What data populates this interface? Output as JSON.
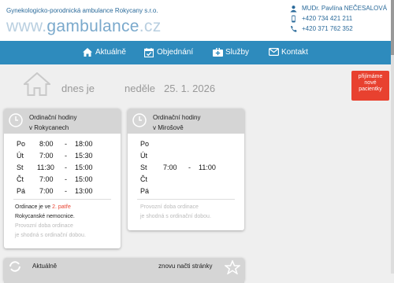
{
  "header": {
    "company": "Gynekologicko-porodnická ambulance Rokycany s.r.o.",
    "logo_prefix": "www.",
    "logo_main": "gambulance",
    "logo_suffix": ".cz",
    "doctor": "MUDr. Pavlína NEČESALOVÁ",
    "phone1": "+420 734 421 211",
    "phone2": "+420 371 762 352"
  },
  "nav": [
    {
      "label": "Aktuálně",
      "icon": "home-icon"
    },
    {
      "label": "Objednání",
      "icon": "calendar-check-icon"
    },
    {
      "label": "Služby",
      "icon": "medkit-icon"
    },
    {
      "label": "Kontakt",
      "icon": "envelope-icon"
    }
  ],
  "date": {
    "prefix": "dnes je",
    "day": "neděle",
    "value": "25. 1. 2026"
  },
  "badge": {
    "line1": "přijímáme",
    "line2": "nové",
    "line3": "pacientky",
    "color": "#e8412f"
  },
  "card_rokycany": {
    "title1": "Ordinační hodiny",
    "title2": "v Rokycanech",
    "rows": [
      {
        "day": "Po",
        "from": "8:00",
        "dash": "-",
        "to": "18:00"
      },
      {
        "day": "Út",
        "from": "7:00",
        "dash": "-",
        "to": "15:30"
      },
      {
        "day": "St",
        "from": "11:30",
        "dash": "-",
        "to": "15:00"
      },
      {
        "day": "Čt",
        "from": "7:00",
        "dash": "-",
        "to": "15:00"
      },
      {
        "day": "Pá",
        "from": "7:00",
        "dash": "-",
        "to": "13:00"
      }
    ],
    "note1_a": "Ordinace je ve",
    "note1_b": "2. patře",
    "note2": "Rokycanské nemocnice.",
    "note3": "Provozní doba ordinace",
    "note4": "je shodná s ordinační dobou."
  },
  "card_mirosov": {
    "title1": "Ordinační hodiny",
    "title2": "v Mirošově",
    "rows": [
      {
        "day": "Po",
        "from": "",
        "dash": "",
        "to": ""
      },
      {
        "day": "Út",
        "from": "",
        "dash": "",
        "to": ""
      },
      {
        "day": "St",
        "from": "7:00",
        "dash": "-",
        "to": "11:00"
      },
      {
        "day": "Čt",
        "from": "",
        "dash": "",
        "to": ""
      },
      {
        "day": "Pá",
        "from": "",
        "dash": "",
        "to": ""
      }
    ],
    "note3": "Provozní doba ordinace",
    "note4": "je shodná s ordinační dobou."
  },
  "card_news": {
    "title": "Aktuálně",
    "reload": "znovu načti stránky"
  },
  "colors": {
    "nav": "#2e8bbd",
    "accent": "#e8412f",
    "link": "#2a6a9a"
  }
}
